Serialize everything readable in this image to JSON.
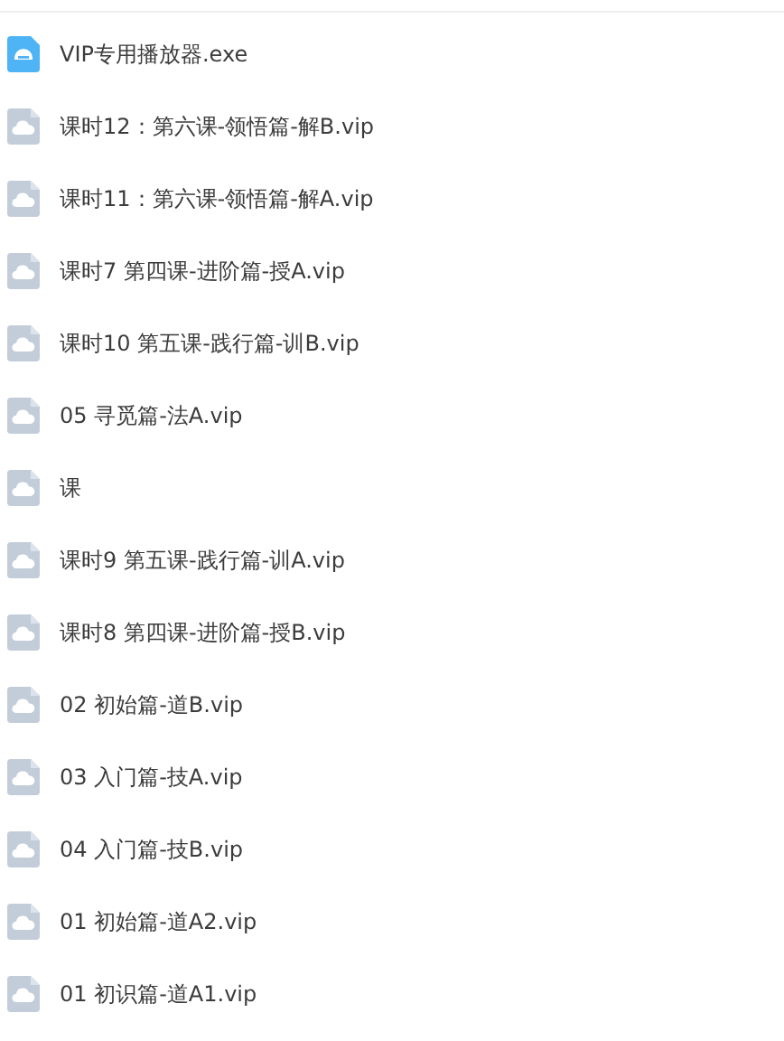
{
  "files": [
    {
      "kind": "app",
      "name": "VIP专用播放器.exe"
    },
    {
      "kind": "cloud",
      "name": "课时12：第六课-领悟篇-解B.vip"
    },
    {
      "kind": "cloud",
      "name": "课时11：第六课-领悟篇-解A.vip"
    },
    {
      "kind": "cloud",
      "name": "课时7 第四课-进阶篇-授A.vip"
    },
    {
      "kind": "cloud",
      "name": "课时10 第五课-践行篇-训B.vip"
    },
    {
      "kind": "cloud",
      "name": "05 寻觅篇-法A.vip"
    },
    {
      "kind": "cloud",
      "name": "课"
    },
    {
      "kind": "cloud",
      "name": "课时9 第五课-践行篇-训A.vip"
    },
    {
      "kind": "cloud",
      "name": "课时8 第四课-进阶篇-授B.vip"
    },
    {
      "kind": "cloud",
      "name": "02 初始篇-道B.vip"
    },
    {
      "kind": "cloud",
      "name": "03 入门篇-技A.vip"
    },
    {
      "kind": "cloud",
      "name": "04 入门篇-技B.vip"
    },
    {
      "kind": "cloud",
      "name": "01 初始篇-道A2.vip"
    },
    {
      "kind": "cloud",
      "name": "01 初识篇-道A1.vip"
    }
  ]
}
